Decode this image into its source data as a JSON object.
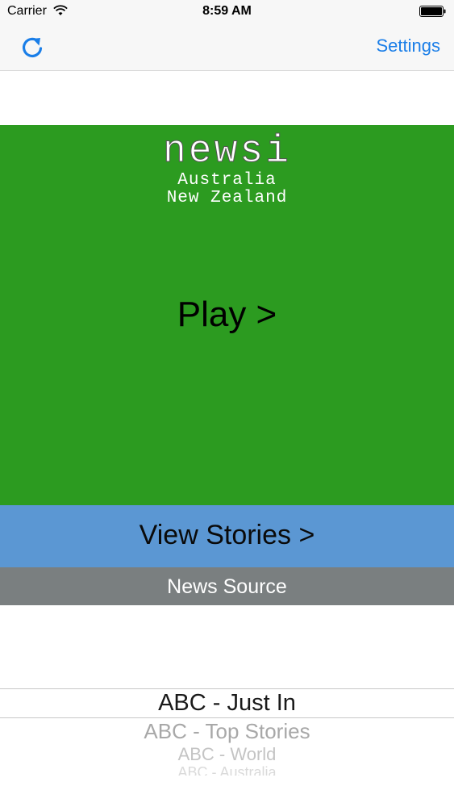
{
  "status_bar": {
    "carrier": "Carrier",
    "time": "8:59 AM",
    "wifi_icon": "wifi-icon",
    "battery_icon": "battery-icon"
  },
  "nav": {
    "refresh_icon": "refresh-icon",
    "settings_label": "Settings"
  },
  "hero": {
    "brand_name": "newsi",
    "brand_line1": "Australia",
    "brand_line2": "New Zealand",
    "play_label": "Play >"
  },
  "view_stories_label": "View Stories >",
  "news_source_label": "News Source",
  "picker": {
    "items": [
      "ABC - Just In",
      "ABC - Top Stories",
      "ABC - World",
      "ABC - Australia"
    ]
  },
  "colors": {
    "hero_green": "#2c9b20",
    "view_stories_blue": "#5b97d3",
    "news_source_gray": "#7a7f80",
    "ios_tint": "#1a7ee8"
  }
}
